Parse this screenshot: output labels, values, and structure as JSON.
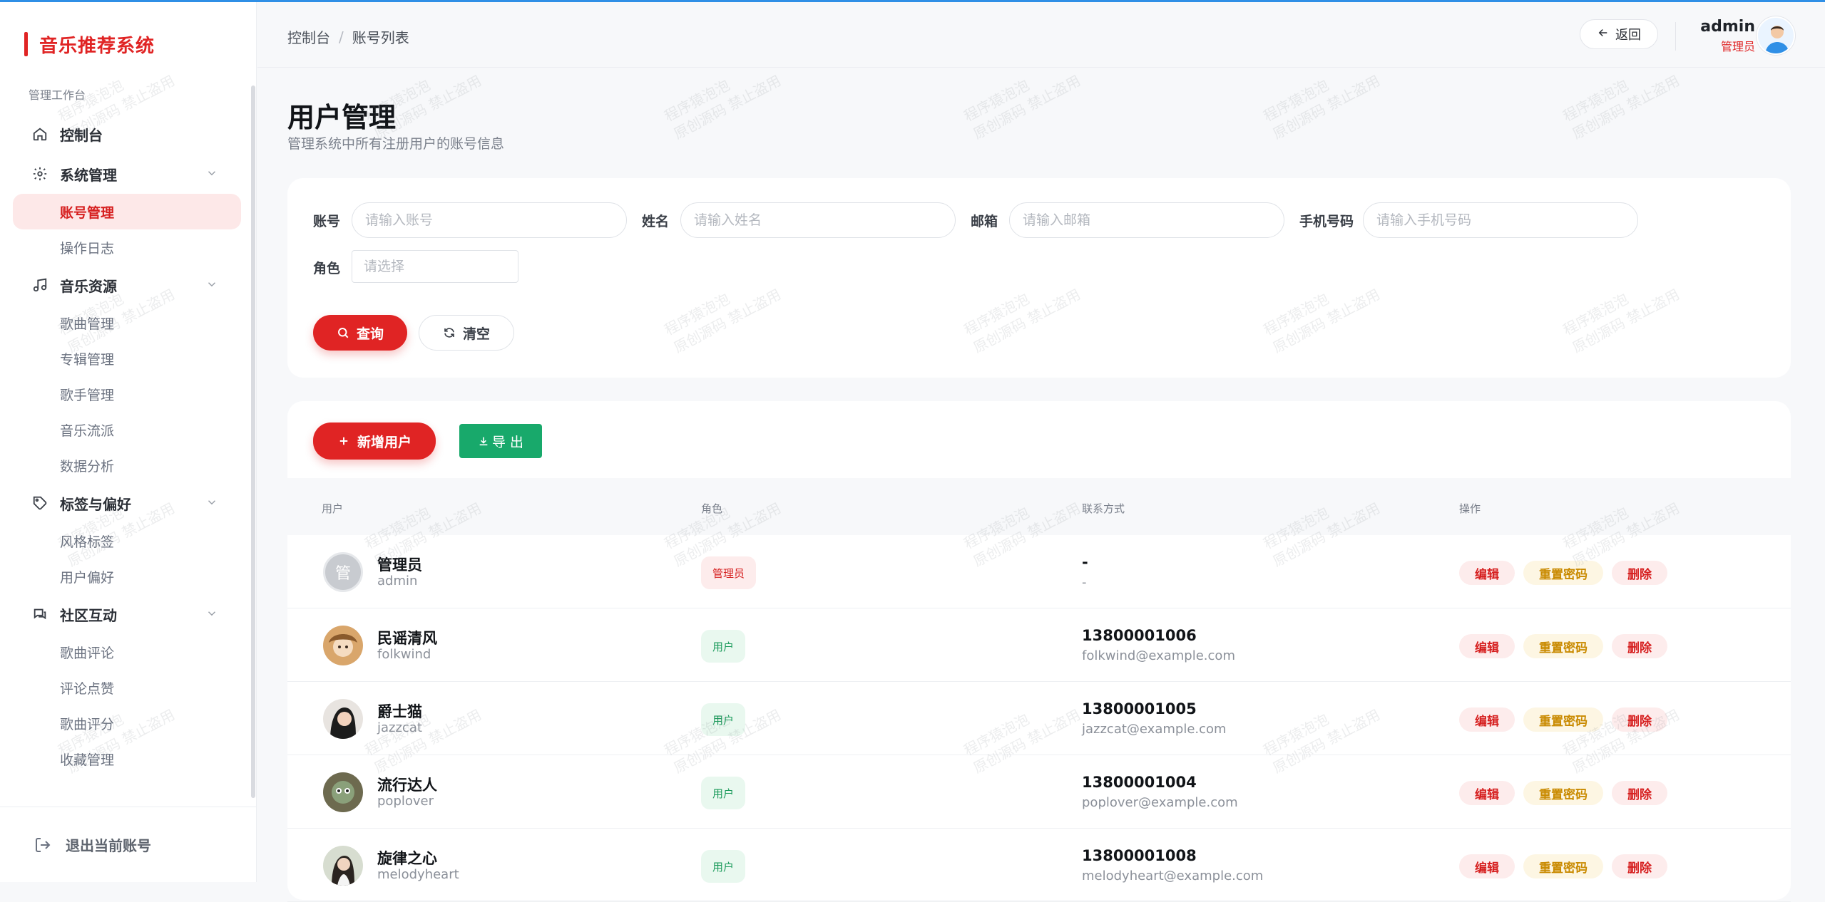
{
  "brand": {
    "title": "音乐推荐系统"
  },
  "sidebar": {
    "section_label": "管理工作台",
    "dashboard": "控制台",
    "groups": [
      {
        "label": "系统管理",
        "icon": "gear-icon",
        "items": [
          "账号管理",
          "操作日志"
        ]
      },
      {
        "label": "音乐资源",
        "icon": "music-note-icon",
        "items": [
          "歌曲管理",
          "专辑管理",
          "歌手管理",
          "音乐流派",
          "数据分析"
        ]
      },
      {
        "label": "标签与偏好",
        "icon": "tag-icon",
        "items": [
          "风格标签",
          "用户偏好"
        ]
      },
      {
        "label": "社区互动",
        "icon": "chat-icon",
        "items": [
          "歌曲评论",
          "评论点赞",
          "歌曲评分",
          "收藏管理"
        ]
      }
    ],
    "active_item": "账号管理",
    "logout": "退出当前账号"
  },
  "header": {
    "breadcrumb": [
      "控制台",
      "账号列表"
    ],
    "back": "返回",
    "user_name": "admin",
    "user_role": "管理员"
  },
  "page": {
    "title": "用户管理",
    "subtitle": "管理系统中所有注册用户的账号信息"
  },
  "filters": {
    "account": {
      "label": "账号",
      "placeholder": "请输入账号"
    },
    "name": {
      "label": "姓名",
      "placeholder": "请输入姓名"
    },
    "email": {
      "label": "邮箱",
      "placeholder": "请输入邮箱"
    },
    "phone": {
      "label": "手机号码",
      "placeholder": "请输入手机号码"
    },
    "role": {
      "label": "角色",
      "placeholder": "请选择"
    },
    "search": "查询",
    "clear": "清空"
  },
  "toolbar": {
    "add": "新增用户",
    "export": "导 出"
  },
  "table": {
    "columns": [
      "用户",
      "角色",
      "联系方式",
      "操作"
    ],
    "actions": {
      "edit": "编辑",
      "reset": "重置密码",
      "delete": "删除"
    },
    "rows": [
      {
        "name": "管理员",
        "account": "admin",
        "avatar_text": "管",
        "role": "管理员",
        "phone": "-",
        "email": "-"
      },
      {
        "name": "民谣清风",
        "account": "folkwind",
        "role": "用户",
        "phone": "13800001006",
        "email": "folkwind@example.com"
      },
      {
        "name": "爵士猫",
        "account": "jazzcat",
        "role": "用户",
        "phone": "13800001005",
        "email": "jazzcat@example.com"
      },
      {
        "name": "流行达人",
        "account": "poplover",
        "role": "用户",
        "phone": "13800001004",
        "email": "poplover@example.com"
      },
      {
        "name": "旋律之心",
        "account": "melodyheart",
        "role": "用户",
        "phone": "13800001008",
        "email": "melodyheart@example.com"
      }
    ]
  },
  "watermark": {
    "line1": "程序猿泡泡",
    "line2": "原创源码 禁止盗用"
  },
  "colors": {
    "accent": "#e02424",
    "export": "#18a96b",
    "warning": "#c98a00",
    "link": "#2f8fe6"
  }
}
